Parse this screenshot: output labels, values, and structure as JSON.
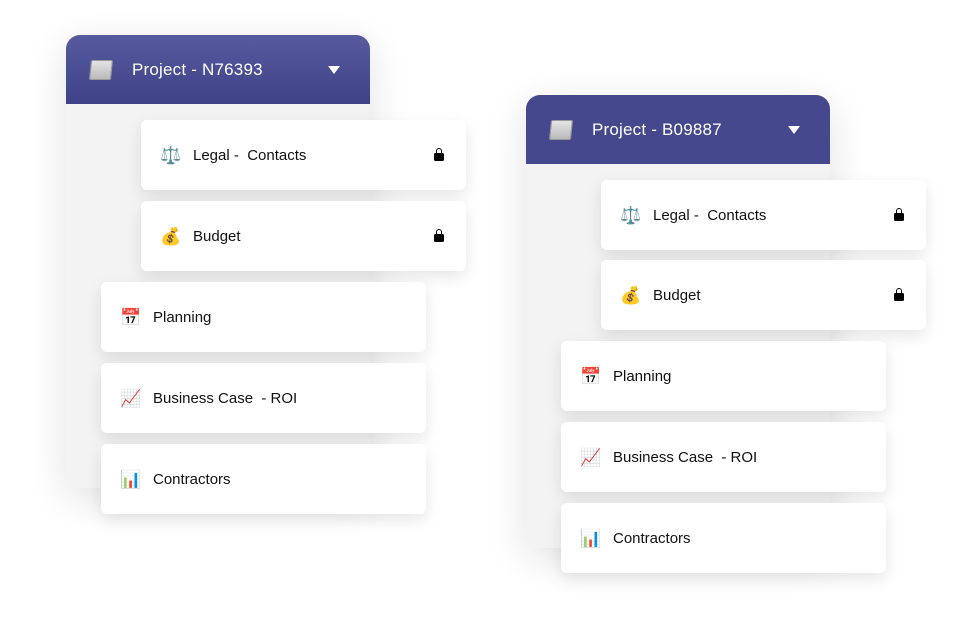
{
  "projects": [
    {
      "title": "Project - N76393",
      "header_icon": "document-icon",
      "items": [
        {
          "label": "Legal -  Contacts",
          "icon": "balance-scale-icon",
          "glyph": "⚖️",
          "locked": true
        },
        {
          "label": "Budget",
          "icon": "money-bag-icon",
          "glyph": "💰",
          "locked": true
        },
        {
          "label": "Planning",
          "icon": "calendar-icon",
          "glyph": "📅",
          "locked": false
        },
        {
          "label": "Business Case  - ROI",
          "icon": "chart-increasing-icon",
          "glyph": "📈",
          "locked": false
        },
        {
          "label": "Contractors",
          "icon": "bar-chart-icon",
          "glyph": "📊",
          "locked": false
        }
      ]
    },
    {
      "title": "Project - B09887",
      "header_icon": "document-icon",
      "items": [
        {
          "label": "Legal -  Contacts",
          "icon": "balance-scale-icon",
          "glyph": "⚖️",
          "locked": true
        },
        {
          "label": "Budget",
          "icon": "money-bag-icon",
          "glyph": "💰",
          "locked": true
        },
        {
          "label": "Planning",
          "icon": "calendar-icon",
          "glyph": "📅",
          "locked": false
        },
        {
          "label": "Business Case  - ROI",
          "icon": "chart-increasing-icon",
          "glyph": "📈",
          "locked": false
        },
        {
          "label": "Contractors",
          "icon": "bar-chart-icon",
          "glyph": "📊",
          "locked": false
        }
      ]
    }
  ]
}
